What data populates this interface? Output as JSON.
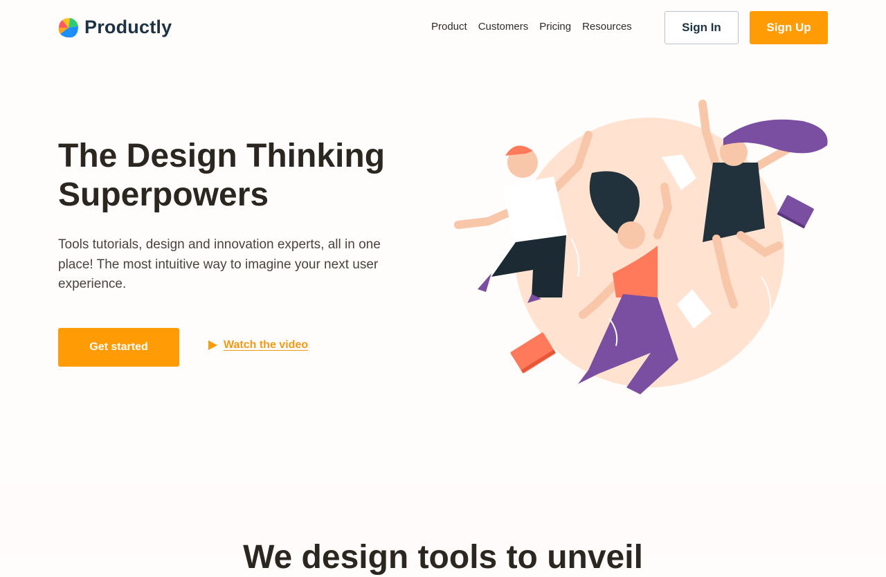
{
  "brand": {
    "name": "Productly",
    "colors": {
      "accent": "#ff9b05",
      "navy": "#1d3343",
      "peach": "#ffe3d0",
      "purple": "#7a4ea0",
      "coral": "#ff7a5a"
    }
  },
  "nav": {
    "links": [
      "Product",
      "Customers",
      "Pricing",
      "Resources"
    ],
    "signin_label": "Sign In",
    "signup_label": "Sign Up"
  },
  "hero": {
    "title_line1": "The Design Thinking",
    "title_line2": "Superpowers",
    "description": "Tools tutorials, design and innovation experts, all in one place! The most intuitive way to imagine your next user experience.",
    "cta_label": "Get started",
    "video_label": "Watch the video",
    "video_icon": "play-icon"
  },
  "next_section": {
    "title": "We design tools to unveil"
  }
}
